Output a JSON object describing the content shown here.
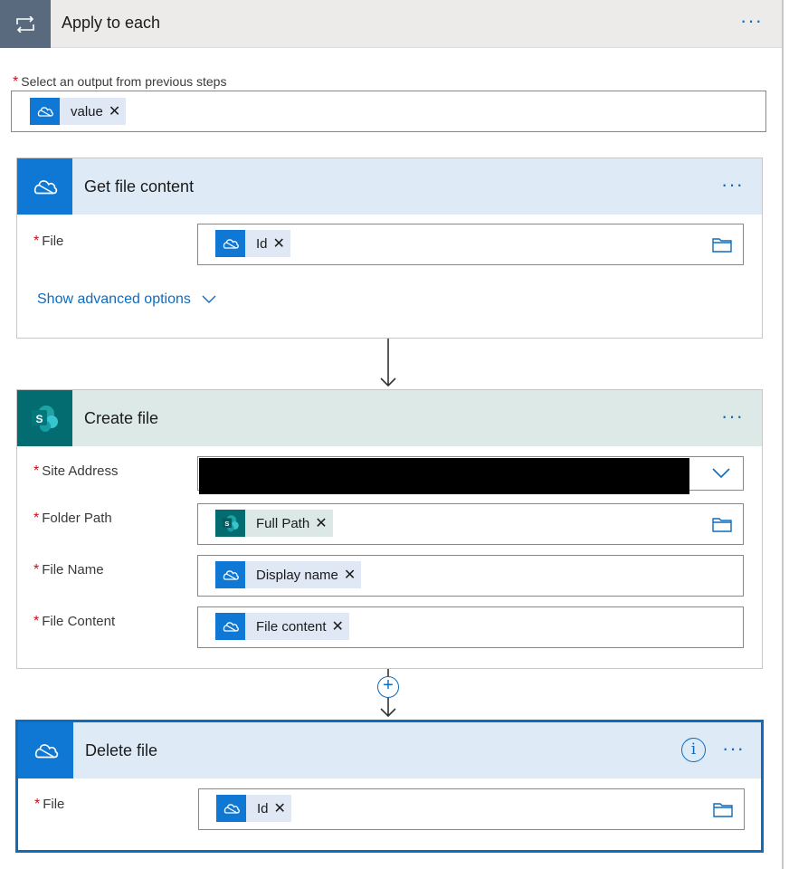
{
  "loop": {
    "title": "Apply to each",
    "more": "···",
    "select_label": "Select an output from previous steps",
    "token": "value"
  },
  "get_file": {
    "title": "Get file content",
    "more": "···",
    "file_label": "File",
    "file_token": "Id",
    "advanced_label": "Show advanced options"
  },
  "create_file": {
    "title": "Create file",
    "more": "···",
    "site_label": "Site Address",
    "folder_label": "Folder Path",
    "folder_token": "Full Path",
    "name_label": "File Name",
    "name_token": "Display name",
    "content_label": "File Content",
    "content_token": "File content"
  },
  "delete_file": {
    "title": "Delete file",
    "more": "···",
    "info": "i",
    "file_label": "File",
    "file_token": "Id"
  },
  "common": {
    "required_mark": "*",
    "remove_glyph": "✕",
    "plus": "+"
  },
  "icons": {
    "loop": "loop-icon",
    "onedrive": "onedrive-icon",
    "sharepoint": "sharepoint-icon",
    "folder": "folder-icon",
    "chevron": "chevron-down-icon"
  },
  "colors": {
    "accent": "#0f6cbd",
    "onedrive": "#0f78d4",
    "sharepoint": "#036c70",
    "loop_header": "#5a6a7e"
  }
}
